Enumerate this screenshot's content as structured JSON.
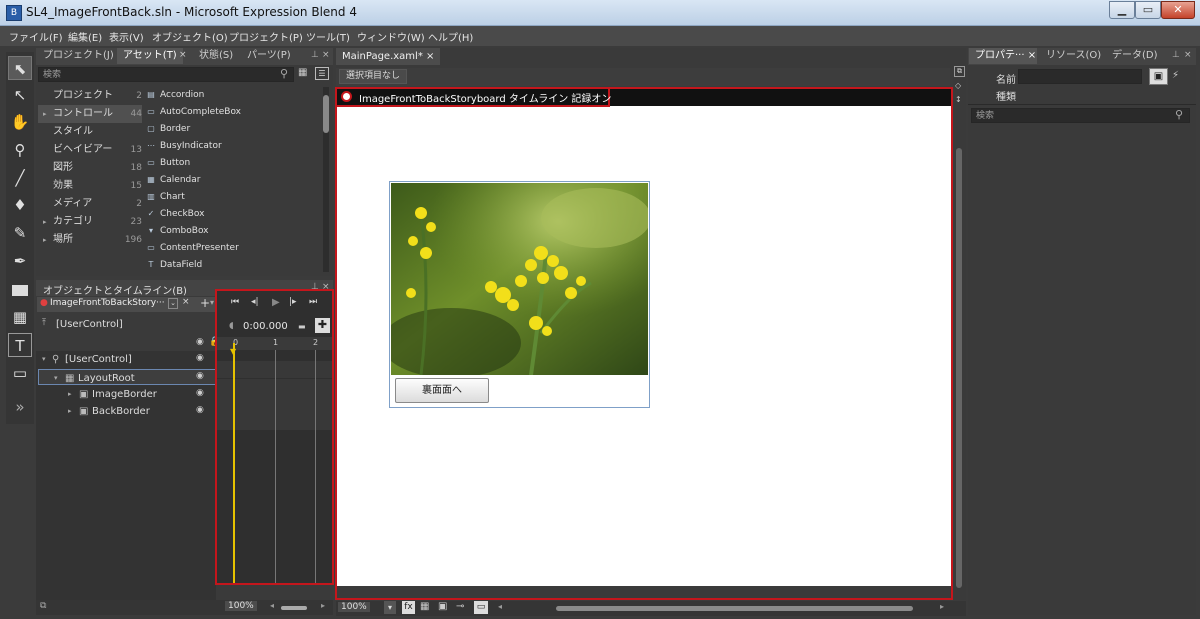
{
  "window": {
    "title": "SL4_ImageFrontBack.sln - Microsoft Expression Blend 4",
    "min": "▁",
    "max": "▭",
    "close": "✕"
  },
  "menu": [
    "ファイル(F)",
    "編集(E)",
    "表示(V)",
    "オブジェクト(O)",
    "プロジェクト(P)",
    "ツール(T)",
    "ウィンドウ(W)",
    "ヘルプ(H)"
  ],
  "left_panel": {
    "tabs": [
      "プロジェクト(J)",
      "アセット(T)",
      "状態(S)",
      "パーツ(P)"
    ],
    "close": "×",
    "search_placeholder": "検索",
    "categories": [
      {
        "arrow": "",
        "label": "プロジェクト",
        "count": "2"
      },
      {
        "arrow": "▸",
        "label": "コントロール",
        "count": "44"
      },
      {
        "arrow": "",
        "label": "スタイル",
        "count": ""
      },
      {
        "arrow": "",
        "label": "ビヘイビアー",
        "count": "13"
      },
      {
        "arrow": "",
        "label": "図形",
        "count": "18"
      },
      {
        "arrow": "",
        "label": "効果",
        "count": "15"
      },
      {
        "arrow": "",
        "label": "メディア",
        "count": "2"
      },
      {
        "arrow": "▸",
        "label": "カテゴリ",
        "count": "23"
      },
      {
        "arrow": "▸",
        "label": "場所",
        "count": "196"
      }
    ],
    "controls": [
      "Accordion",
      "AutoCompleteBox",
      "Border",
      "BusyIndicator",
      "Button",
      "Calendar",
      "Chart",
      "CheckBox",
      "ComboBox",
      "ContentPresenter",
      "DataField"
    ]
  },
  "objects_panel": {
    "title": "オブジェクトとタイムライン(B)",
    "storyboard": "ImageFrontToBackStory···",
    "root": "[UserControl]",
    "tree": [
      {
        "label": "[UserControl]",
        "arrow": "▾"
      },
      {
        "label": "LayoutRoot",
        "arrow": "▾"
      },
      {
        "label": "ImageBorder",
        "arrow": "▸"
      },
      {
        "label": "BackBorder",
        "arrow": "▸"
      }
    ],
    "time": "0:00.000",
    "ruler": [
      "0",
      "1",
      "2"
    ],
    "zoom": "100%"
  },
  "document": {
    "tab": "MainPage.xaml*",
    "close": "×",
    "breadcrumb": "選択項目なし",
    "recording": "ImageFrontToBackStoryboard タイムライン 記録オン",
    "button_label": "裏面面へ",
    "zoom": "100%"
  },
  "right_panel": {
    "tabs": [
      "プロパテ···",
      "リソース(O)",
      "データ(D)"
    ],
    "close": "×",
    "name_label": "名前",
    "type_label": "種類",
    "search_placeholder": "検索"
  }
}
